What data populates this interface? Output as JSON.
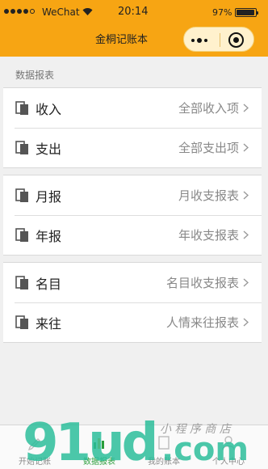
{
  "status_bar": {
    "carrier": "WeChat",
    "time": "20:14",
    "battery": "97%"
  },
  "nav": {
    "title": "金桐记账本"
  },
  "section": {
    "title": "数据报表"
  },
  "groups": [
    {
      "rows": [
        {
          "label": "收入",
          "value": "全部收入项"
        },
        {
          "label": "支出",
          "value": "全部支出项"
        }
      ]
    },
    {
      "rows": [
        {
          "label": "月报",
          "value": "月收支报表"
        },
        {
          "label": "年报",
          "value": "年收支报表"
        }
      ]
    },
    {
      "rows": [
        {
          "label": "名目",
          "value": "名目收支报表"
        },
        {
          "label": "来往",
          "value": "人情来往报表"
        }
      ]
    }
  ],
  "tabbar": {
    "tabs": [
      {
        "label": "开始记账",
        "active": false
      },
      {
        "label": "数据报表",
        "active": true
      },
      {
        "label": "我的账本",
        "active": false
      },
      {
        "label": "个人中心",
        "active": false
      }
    ]
  },
  "watermark": {
    "brand": "91ud",
    "tld": ".com",
    "tagline": "小 程 序 商 店"
  },
  "colors": {
    "accent": "#f7a513",
    "active_tab": "#2a9d3a",
    "watermark_green": "#2bbd9a"
  }
}
